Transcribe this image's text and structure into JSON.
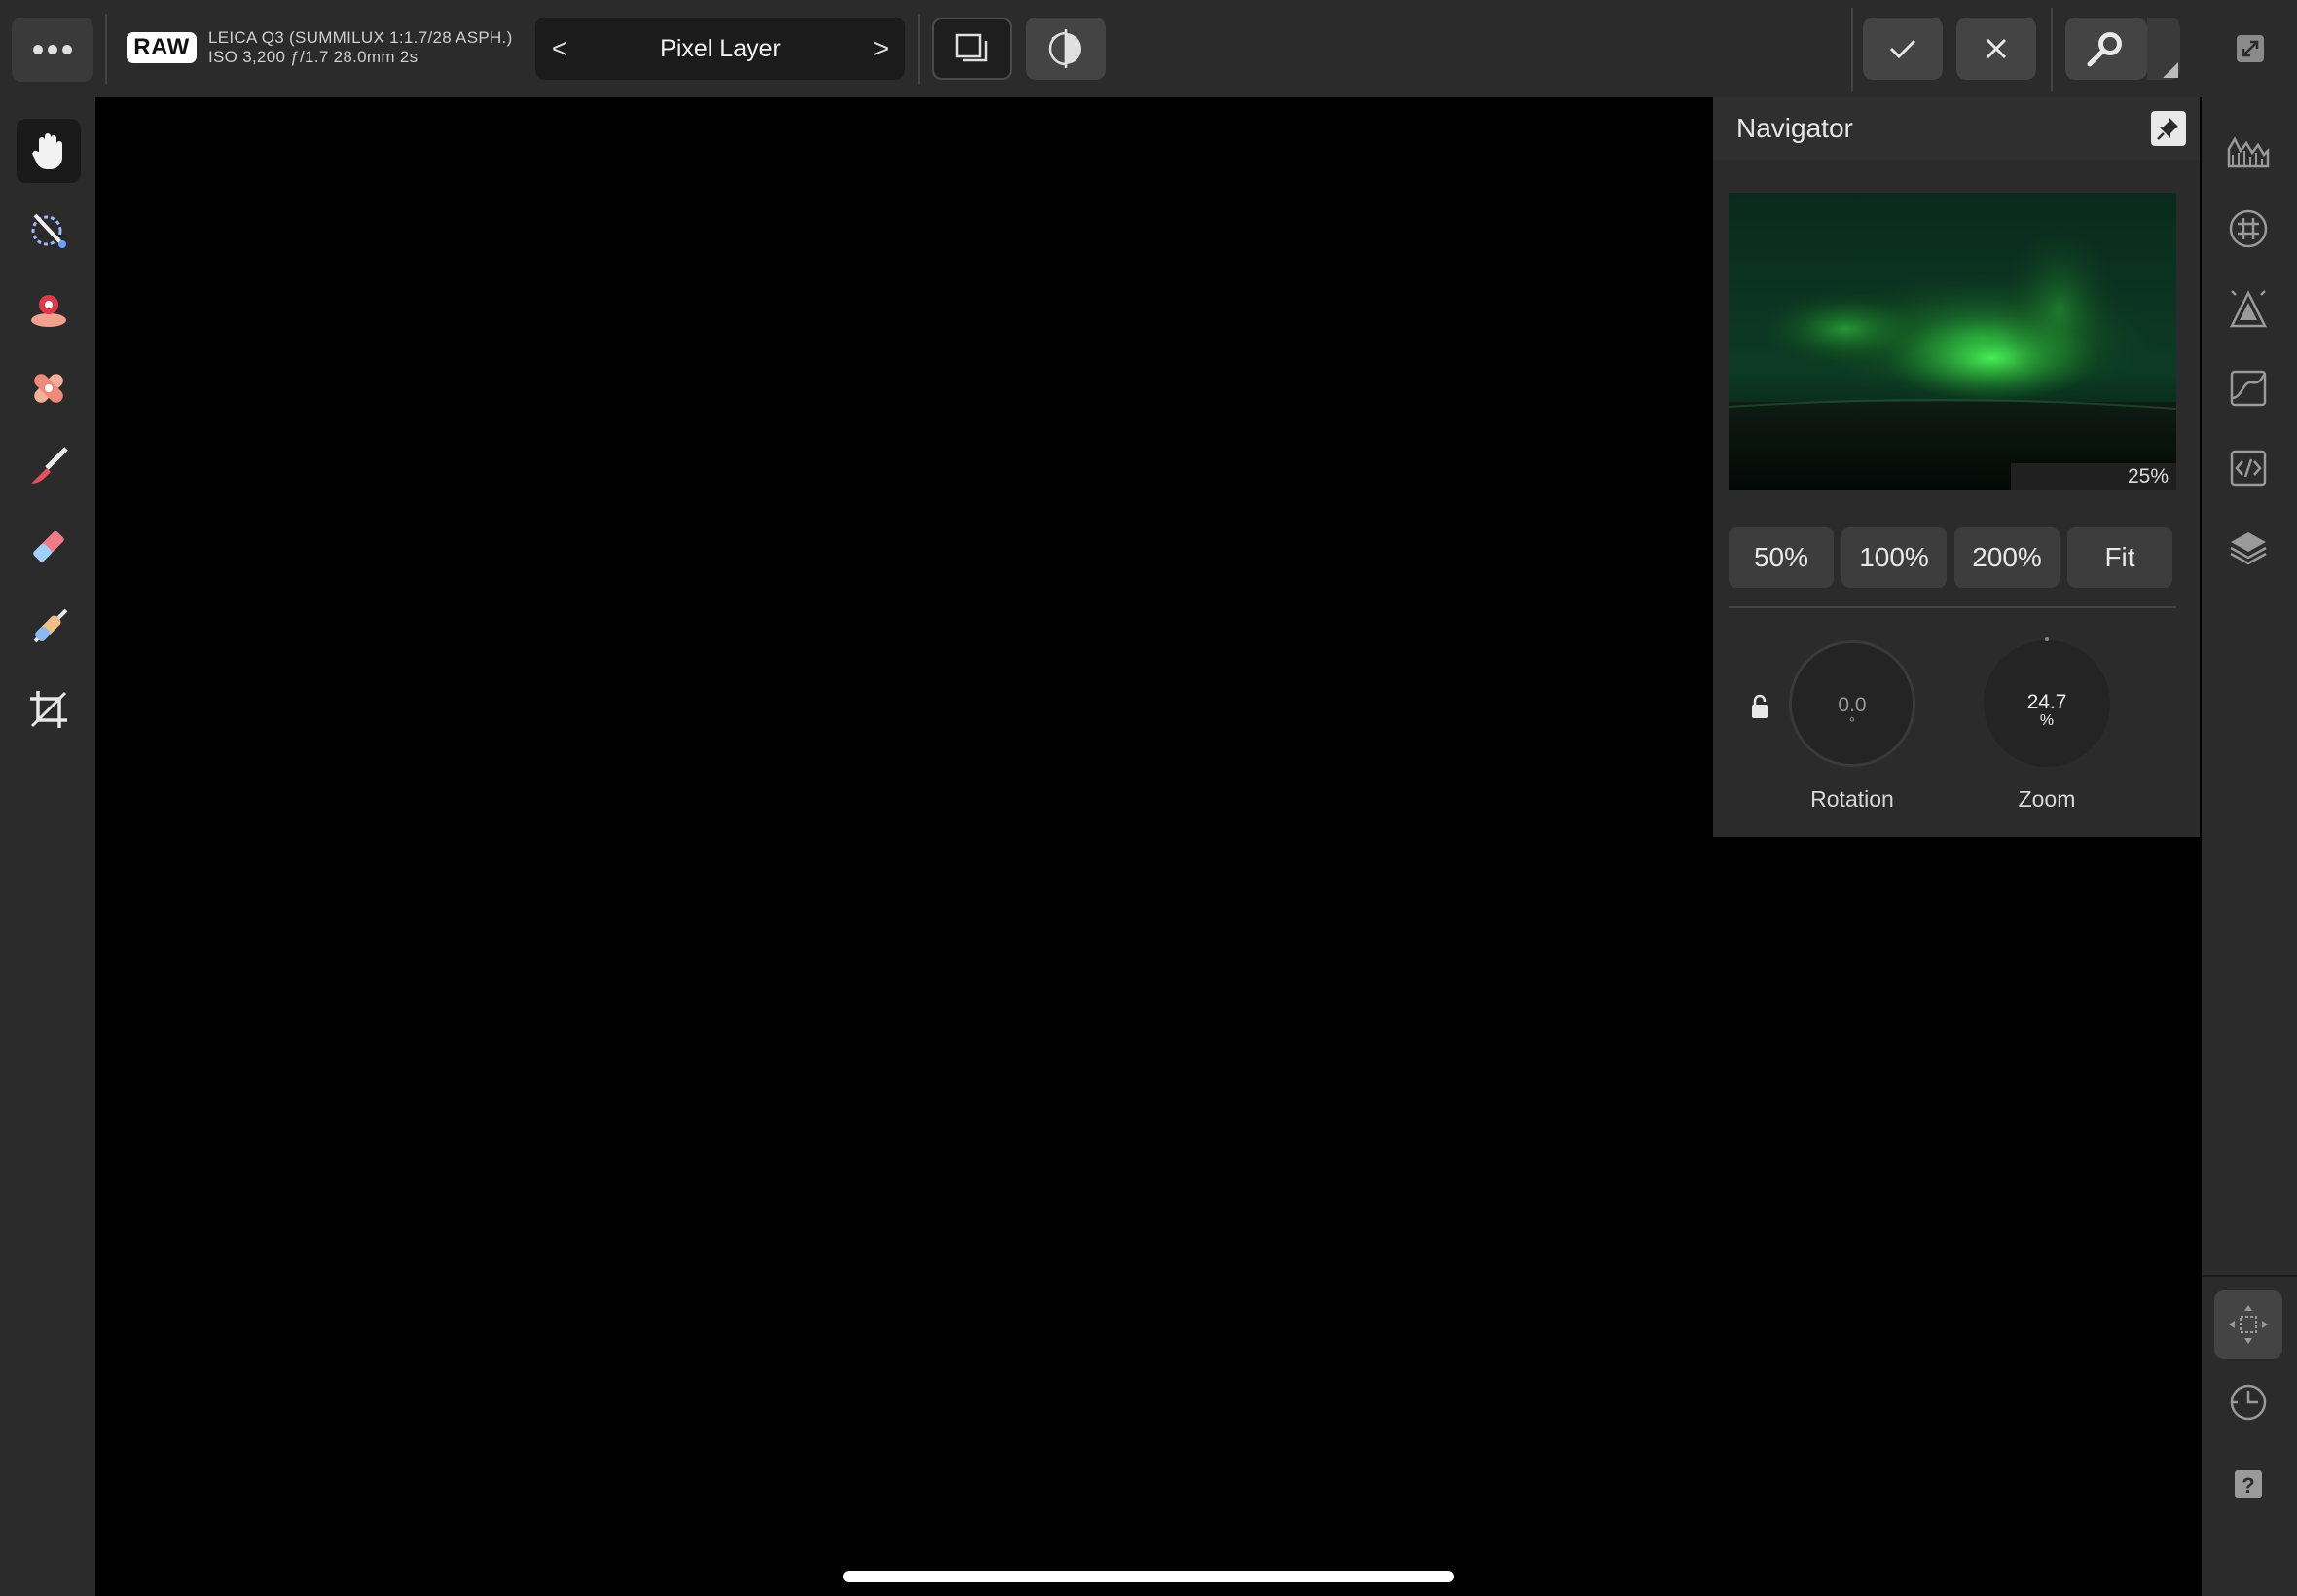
{
  "topbar": {
    "raw_badge": "RAW",
    "camera_line1": "LEICA Q3 (SUMMILUX 1:1.7/28 ASPH.)",
    "camera_line2": "ISO 3,200 ƒ/1.7 28.0mm 2s",
    "prev_arrow": "<",
    "next_arrow": ">",
    "layer_title": "Pixel Layer"
  },
  "left_tools": [
    "hand-tool-icon",
    "selection-brush-icon",
    "inpainting-icon",
    "healing-icon",
    "paint-brush-icon",
    "erase-brush-icon",
    "clone-brush-icon",
    "crop-icon"
  ],
  "right_tools": [
    "histogram-icon",
    "grid-icon",
    "brush-studio-icon",
    "curves-icon",
    "code-icon",
    "layers-icon"
  ],
  "navigator": {
    "title": "Navigator",
    "preview_zoom": "25%",
    "zoom_buttons": [
      "50%",
      "100%",
      "200%",
      "Fit"
    ],
    "rotation": {
      "value": "0.0",
      "unit": "°",
      "label": "Rotation"
    },
    "zoom": {
      "value": "24.7",
      "unit": "%",
      "label": "Zoom"
    }
  }
}
